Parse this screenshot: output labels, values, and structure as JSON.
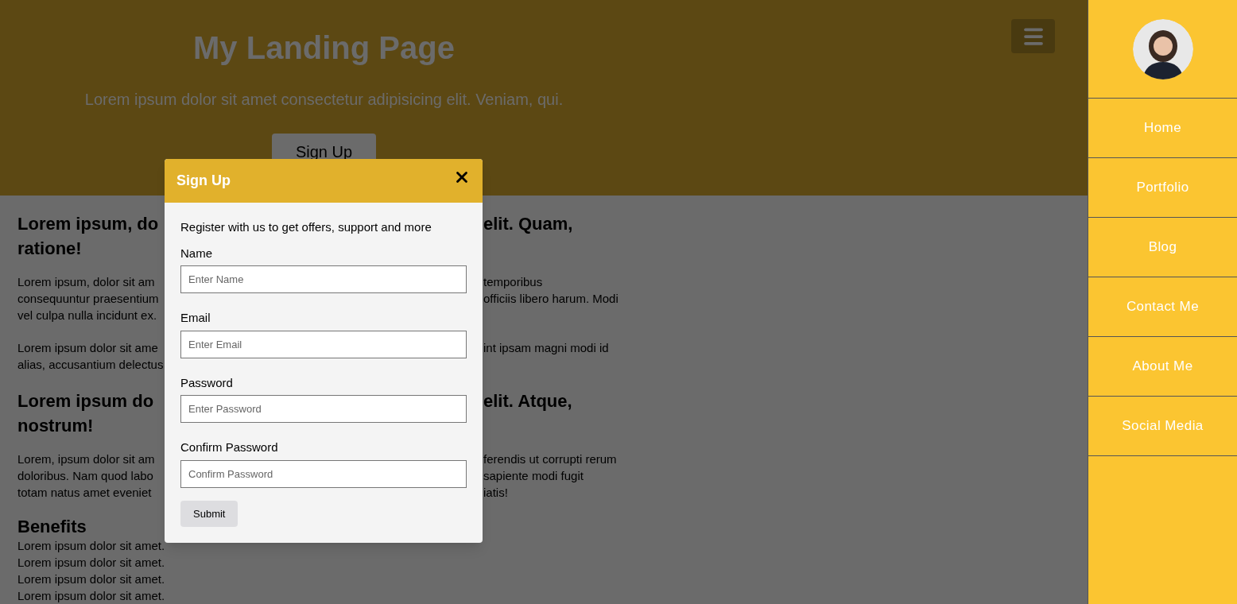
{
  "header": {
    "title": "My Landing Page",
    "subtitle": "Lorem ipsum dolor sit amet consectetur adipisicing elit. Veniam, qui.",
    "button": "Sign Up"
  },
  "content": [
    {
      "kind": "heading",
      "lines": [
        {
          "left": "Lorem ipsum, do",
          "right": "elit. Quam,"
        },
        {
          "left": "ratione!"
        }
      ]
    },
    {
      "kind": "paragraph",
      "lines": [
        {
          "left": "Lorem ipsum, dolor sit am",
          "right": "temporibus"
        },
        {
          "left": "consequuntur praesentium",
          "right": "officiis libero harum. Modi"
        },
        {
          "left": "vel culpa nulla incidunt ex."
        }
      ]
    },
    {
      "kind": "paragraph",
      "lines": [
        {
          "left": "Lorem ipsum dolor sit ame",
          "right": "int ipsam magni modi id"
        },
        {
          "left": "alias, accusantium delectus"
        }
      ]
    },
    {
      "kind": "heading",
      "lines": [
        {
          "left": "Lorem ipsum do",
          "right": "elit. Atque,"
        },
        {
          "left": "nostrum!"
        }
      ]
    },
    {
      "kind": "paragraph",
      "lines": [
        {
          "left": "Lorem, ipsum dolor sit am",
          "right": "ferendis ut corrupti rerum"
        },
        {
          "left": "doloribus. Nam quod labo",
          "right": "sapiente modi fugit"
        },
        {
          "left": "totam natus amet eveniet",
          "right": "iatis!"
        }
      ]
    },
    {
      "kind": "subheading",
      "lines": [
        {
          "left": "Benefits"
        }
      ]
    },
    {
      "kind": "list",
      "lines": [
        {
          "left": "Lorem ipsum dolor sit amet."
        },
        {
          "left": "Lorem ipsum dolor sit amet."
        },
        {
          "left": "Lorem ipsum dolor sit amet."
        },
        {
          "left": "Lorem ipsum dolor sit amet."
        }
      ]
    }
  ],
  "modal": {
    "title": "Sign Up",
    "intro": "Register with us to get offers, support and more",
    "fields": [
      {
        "label": "Name",
        "placeholder": "Enter Name"
      },
      {
        "label": "Email",
        "placeholder": "Enter Email"
      },
      {
        "label": "Password",
        "placeholder": "Enter Password"
      },
      {
        "label": "Confirm Password",
        "placeholder": "Confirm Password"
      }
    ],
    "submit": "Submit"
  },
  "sidebar": {
    "items": [
      "Home",
      "Portfolio",
      "Blog",
      "Contact Me",
      "About Me",
      "Social Media"
    ]
  }
}
